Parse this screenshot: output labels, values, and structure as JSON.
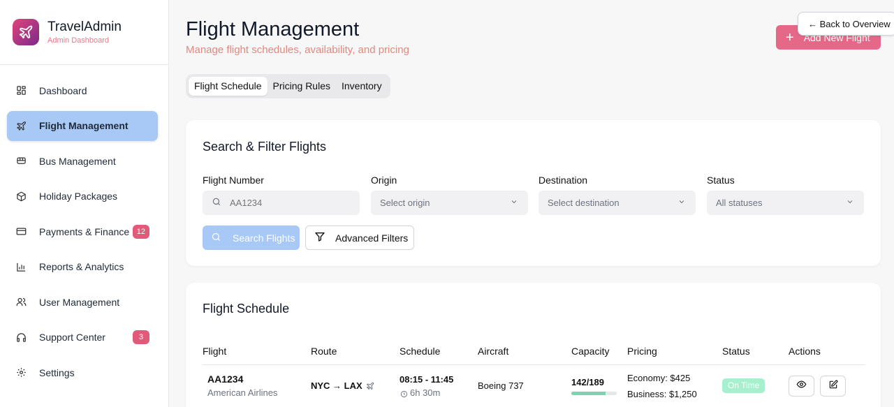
{
  "brand": {
    "name": "TravelAdmin",
    "subtitle": "Admin Dashboard"
  },
  "sidebar": {
    "items": [
      {
        "label": "Dashboard",
        "icon": "grid-icon"
      },
      {
        "label": "Flight Management",
        "icon": "plane-icon",
        "active": true
      },
      {
        "label": "Bus Management",
        "icon": "bus-icon"
      },
      {
        "label": "Holiday Packages",
        "icon": "package-icon"
      },
      {
        "label": "Payments & Finance",
        "icon": "credit-card-icon",
        "badge": "12"
      },
      {
        "label": "Reports & Analytics",
        "icon": "bar-chart-icon"
      },
      {
        "label": "User Management",
        "icon": "users-icon"
      },
      {
        "label": "Support Center",
        "icon": "headphones-icon",
        "badge": "3"
      },
      {
        "label": "Settings",
        "icon": "gear-icon"
      }
    ]
  },
  "header": {
    "title": "Flight Management",
    "subtitle": "Manage flight schedules, availability, and pricing",
    "add_button": "Add New Flight",
    "back_button": "← Back to Overview"
  },
  "tabs": [
    {
      "label": "Flight Schedule",
      "active": true
    },
    {
      "label": "Pricing Rules"
    },
    {
      "label": "Inventory"
    }
  ],
  "search": {
    "title": "Search & Filter Flights",
    "flight_number_label": "Flight Number",
    "flight_number_placeholder": "AA1234",
    "origin_label": "Origin",
    "origin_value": "Select origin",
    "destination_label": "Destination",
    "destination_value": "Select destination",
    "status_label": "Status",
    "status_value": "All statuses",
    "search_button": "Search Flights",
    "filters_button": "Advanced Filters"
  },
  "schedule": {
    "title": "Flight Schedule",
    "columns": [
      "Flight",
      "Route",
      "Schedule",
      "Aircraft",
      "Capacity",
      "Pricing",
      "Status",
      "Actions"
    ],
    "rows": [
      {
        "flight": "AA1234",
        "airline": "American Airlines",
        "route": "NYC → LAX",
        "time": "08:15 - 11:45",
        "duration": "6h 30m",
        "aircraft": "Boeing 737",
        "capacity": "142/189",
        "capacity_fraction": 0.75,
        "economy": "Economy: $425",
        "business": "Business: $1,250",
        "status": "On Time"
      }
    ]
  },
  "colors": {
    "accent": "#e66888",
    "active_nav": "#a8c8f5",
    "badge": "#e05a7a",
    "status_on_time": "#a7f0cf"
  }
}
